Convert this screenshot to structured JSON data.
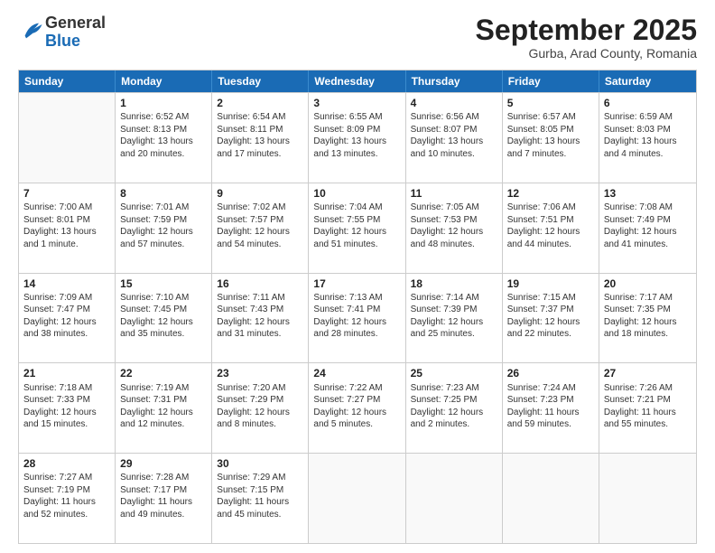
{
  "header": {
    "logo": {
      "line1": "General",
      "line2": "Blue"
    },
    "month": "September 2025",
    "location": "Gurba, Arad County, Romania"
  },
  "weekdays": [
    "Sunday",
    "Monday",
    "Tuesday",
    "Wednesday",
    "Thursday",
    "Friday",
    "Saturday"
  ],
  "rows": [
    [
      {
        "day": "",
        "info": ""
      },
      {
        "day": "1",
        "info": "Sunrise: 6:52 AM\nSunset: 8:13 PM\nDaylight: 13 hours\nand 20 minutes."
      },
      {
        "day": "2",
        "info": "Sunrise: 6:54 AM\nSunset: 8:11 PM\nDaylight: 13 hours\nand 17 minutes."
      },
      {
        "day": "3",
        "info": "Sunrise: 6:55 AM\nSunset: 8:09 PM\nDaylight: 13 hours\nand 13 minutes."
      },
      {
        "day": "4",
        "info": "Sunrise: 6:56 AM\nSunset: 8:07 PM\nDaylight: 13 hours\nand 10 minutes."
      },
      {
        "day": "5",
        "info": "Sunrise: 6:57 AM\nSunset: 8:05 PM\nDaylight: 13 hours\nand 7 minutes."
      },
      {
        "day": "6",
        "info": "Sunrise: 6:59 AM\nSunset: 8:03 PM\nDaylight: 13 hours\nand 4 minutes."
      }
    ],
    [
      {
        "day": "7",
        "info": "Sunrise: 7:00 AM\nSunset: 8:01 PM\nDaylight: 13 hours\nand 1 minute."
      },
      {
        "day": "8",
        "info": "Sunrise: 7:01 AM\nSunset: 7:59 PM\nDaylight: 12 hours\nand 57 minutes."
      },
      {
        "day": "9",
        "info": "Sunrise: 7:02 AM\nSunset: 7:57 PM\nDaylight: 12 hours\nand 54 minutes."
      },
      {
        "day": "10",
        "info": "Sunrise: 7:04 AM\nSunset: 7:55 PM\nDaylight: 12 hours\nand 51 minutes."
      },
      {
        "day": "11",
        "info": "Sunrise: 7:05 AM\nSunset: 7:53 PM\nDaylight: 12 hours\nand 48 minutes."
      },
      {
        "day": "12",
        "info": "Sunrise: 7:06 AM\nSunset: 7:51 PM\nDaylight: 12 hours\nand 44 minutes."
      },
      {
        "day": "13",
        "info": "Sunrise: 7:08 AM\nSunset: 7:49 PM\nDaylight: 12 hours\nand 41 minutes."
      }
    ],
    [
      {
        "day": "14",
        "info": "Sunrise: 7:09 AM\nSunset: 7:47 PM\nDaylight: 12 hours\nand 38 minutes."
      },
      {
        "day": "15",
        "info": "Sunrise: 7:10 AM\nSunset: 7:45 PM\nDaylight: 12 hours\nand 35 minutes."
      },
      {
        "day": "16",
        "info": "Sunrise: 7:11 AM\nSunset: 7:43 PM\nDaylight: 12 hours\nand 31 minutes."
      },
      {
        "day": "17",
        "info": "Sunrise: 7:13 AM\nSunset: 7:41 PM\nDaylight: 12 hours\nand 28 minutes."
      },
      {
        "day": "18",
        "info": "Sunrise: 7:14 AM\nSunset: 7:39 PM\nDaylight: 12 hours\nand 25 minutes."
      },
      {
        "day": "19",
        "info": "Sunrise: 7:15 AM\nSunset: 7:37 PM\nDaylight: 12 hours\nand 22 minutes."
      },
      {
        "day": "20",
        "info": "Sunrise: 7:17 AM\nSunset: 7:35 PM\nDaylight: 12 hours\nand 18 minutes."
      }
    ],
    [
      {
        "day": "21",
        "info": "Sunrise: 7:18 AM\nSunset: 7:33 PM\nDaylight: 12 hours\nand 15 minutes."
      },
      {
        "day": "22",
        "info": "Sunrise: 7:19 AM\nSunset: 7:31 PM\nDaylight: 12 hours\nand 12 minutes."
      },
      {
        "day": "23",
        "info": "Sunrise: 7:20 AM\nSunset: 7:29 PM\nDaylight: 12 hours\nand 8 minutes."
      },
      {
        "day": "24",
        "info": "Sunrise: 7:22 AM\nSunset: 7:27 PM\nDaylight: 12 hours\nand 5 minutes."
      },
      {
        "day": "25",
        "info": "Sunrise: 7:23 AM\nSunset: 7:25 PM\nDaylight: 12 hours\nand 2 minutes."
      },
      {
        "day": "26",
        "info": "Sunrise: 7:24 AM\nSunset: 7:23 PM\nDaylight: 11 hours\nand 59 minutes."
      },
      {
        "day": "27",
        "info": "Sunrise: 7:26 AM\nSunset: 7:21 PM\nDaylight: 11 hours\nand 55 minutes."
      }
    ],
    [
      {
        "day": "28",
        "info": "Sunrise: 7:27 AM\nSunset: 7:19 PM\nDaylight: 11 hours\nand 52 minutes."
      },
      {
        "day": "29",
        "info": "Sunrise: 7:28 AM\nSunset: 7:17 PM\nDaylight: 11 hours\nand 49 minutes."
      },
      {
        "day": "30",
        "info": "Sunrise: 7:29 AM\nSunset: 7:15 PM\nDaylight: 11 hours\nand 45 minutes."
      },
      {
        "day": "",
        "info": ""
      },
      {
        "day": "",
        "info": ""
      },
      {
        "day": "",
        "info": ""
      },
      {
        "day": "",
        "info": ""
      }
    ]
  ]
}
